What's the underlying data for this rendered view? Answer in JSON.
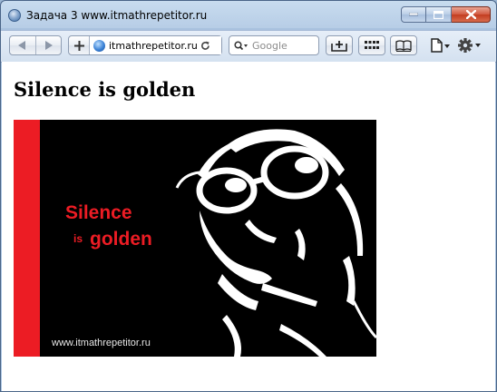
{
  "window": {
    "title": "Задача 3 www.itmathrepetitor.ru"
  },
  "toolbar": {
    "url": "itmathrepetitor.ru",
    "search_placeholder": "Google"
  },
  "page": {
    "heading": "Silence is golden"
  },
  "poster": {
    "word1": "Silence",
    "word2": "is",
    "word3": "golden",
    "site": "www.itmathrepetitor.ru",
    "accent_color": "#ec1c24"
  }
}
